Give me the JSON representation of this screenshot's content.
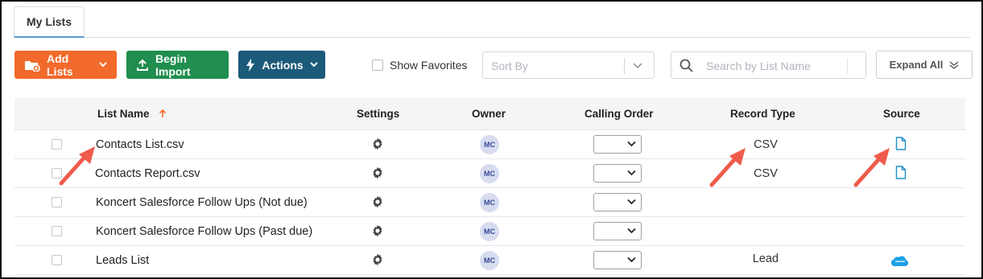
{
  "tabs": {
    "my_lists": "My Lists"
  },
  "toolbar": {
    "add_lists": "Add Lists",
    "begin_import": "Begin Import",
    "actions": "Actions",
    "show_favorites": "Show Favorites",
    "sort_by_placeholder": "Sort By",
    "search_placeholder": "Search by List Name",
    "expand_all": "Expand All"
  },
  "colors": {
    "add_lists": "#f26a2b",
    "begin_import": "#1f8e4e",
    "actions": "#1c5a7a",
    "annotation_arrow": "#ef5b4b"
  },
  "table": {
    "headers": {
      "list_name": "List Name",
      "settings": "Settings",
      "owner": "Owner",
      "calling_order": "Calling Order",
      "record_type": "Record Type",
      "source": "Source"
    },
    "sort": {
      "column": "List Name",
      "direction": "ascending"
    },
    "rows": [
      {
        "name": "Contacts List.csv",
        "owner": "MC",
        "record_type": "CSV",
        "source_icon": "file-icon"
      },
      {
        "name": "Contacts Report.csv",
        "owner": "MC",
        "record_type": "CSV",
        "source_icon": "file-icon"
      },
      {
        "name": "Koncert Salesforce Follow Ups (Not due)",
        "owner": "MC",
        "record_type": "",
        "source_icon": ""
      },
      {
        "name": "Koncert Salesforce Follow Ups (Past due)",
        "owner": "MC",
        "record_type": "",
        "source_icon": ""
      },
      {
        "name": "Leads List",
        "owner": "MC",
        "record_type": "Lead",
        "source_icon": "salesforce-icon"
      }
    ]
  }
}
